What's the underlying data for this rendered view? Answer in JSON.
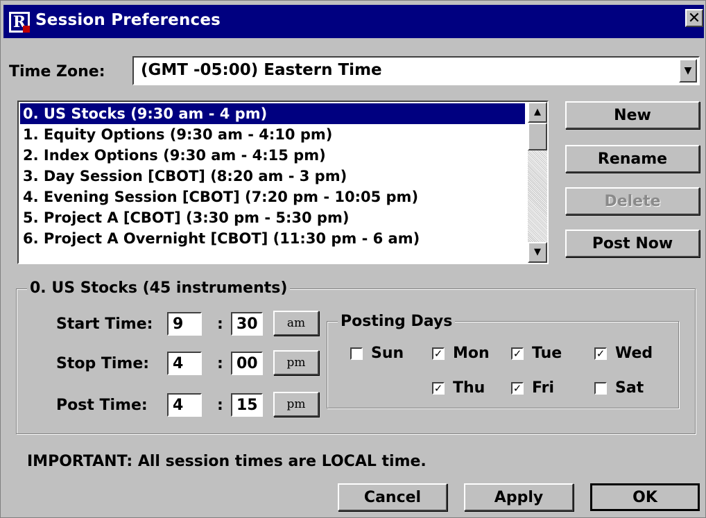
{
  "window": {
    "title": "Session Preferences",
    "close_glyph": "✕",
    "app_icon_letter": "R"
  },
  "time_zone": {
    "label": "Time Zone:",
    "value": "(GMT -05:00) Eastern Time"
  },
  "sessions": [
    "0. US Stocks (9:30 am - 4 pm)",
    "1. Equity Options (9:30 am - 4:10 pm)",
    "2. Index Options (9:30 am - 4:15 pm)",
    "3. Day Session [CBOT] (8:20 am - 3 pm)",
    "4. Evening Session [CBOT] (7:20 pm - 10:05 pm)",
    "5. Project A [CBOT] (3:30 pm - 5:30 pm)",
    "6. Project A Overnight [CBOT] (11:30 pm - 6 am)"
  ],
  "selected_session_index": 0,
  "buttons": {
    "new": "New",
    "rename": "Rename",
    "delete": "Delete",
    "post_now": "Post Now",
    "cancel": "Cancel",
    "apply": "Apply",
    "ok": "OK"
  },
  "details": {
    "group_title": "0. US Stocks (45 instruments)",
    "start": {
      "label": "Start Time:",
      "hour": "9",
      "minute": "30",
      "ampm": "am"
    },
    "stop": {
      "label": "Stop Time:",
      "hour": "4",
      "minute": "00",
      "ampm": "pm"
    },
    "post": {
      "label": "Post Time:",
      "hour": "4",
      "minute": "15",
      "ampm": "pm"
    },
    "colon": ":"
  },
  "posting_days": {
    "title": "Posting Days",
    "days": [
      {
        "label": "Sun",
        "checked": false
      },
      {
        "label": "Mon",
        "checked": true
      },
      {
        "label": "Tue",
        "checked": true
      },
      {
        "label": "Wed",
        "checked": true
      },
      {
        "label": "Thu",
        "checked": true
      },
      {
        "label": "Fri",
        "checked": true
      },
      {
        "label": "Sat",
        "checked": false
      }
    ]
  },
  "note": "IMPORTANT:  All session times are LOCAL time."
}
